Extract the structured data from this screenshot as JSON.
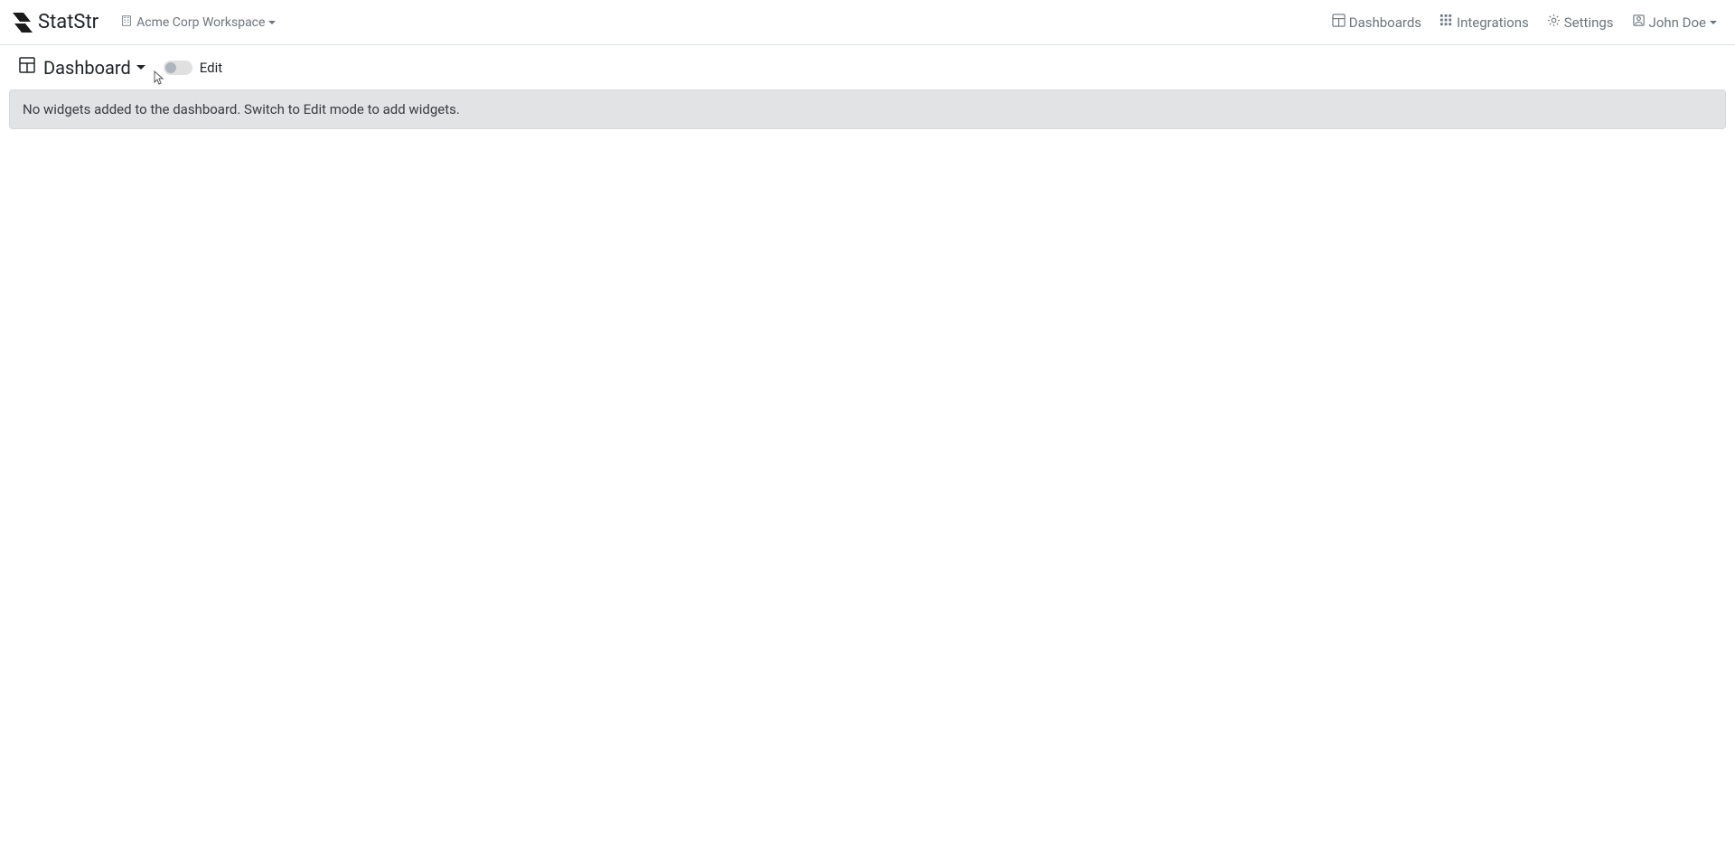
{
  "brand": {
    "name": "StatStr"
  },
  "workspace": {
    "label": "Acme Corp Workspace"
  },
  "nav": {
    "dashboards": "Dashboards",
    "integrations": "Integrations",
    "settings": "Settings",
    "user": "John Doe"
  },
  "toolbar": {
    "dashboard_label": "Dashboard",
    "edit_label": "Edit"
  },
  "content": {
    "empty_message": "No widgets added to the dashboard. Switch to Edit mode to add widgets."
  }
}
